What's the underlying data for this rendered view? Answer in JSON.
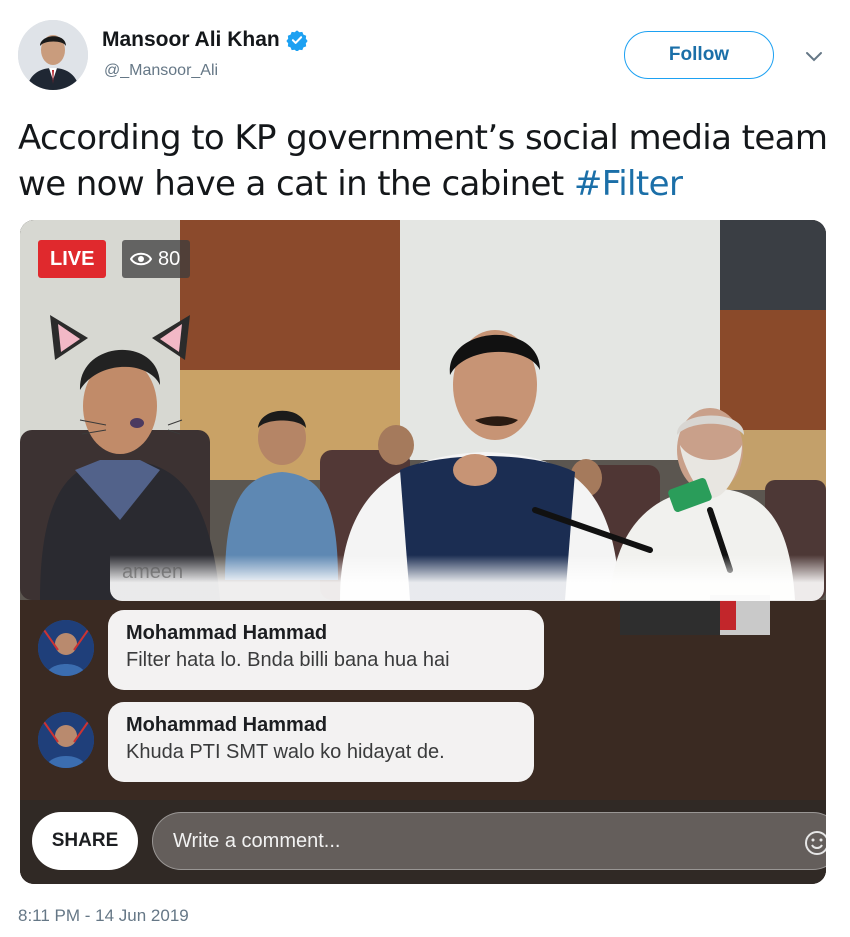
{
  "tweet": {
    "author": {
      "display_name": "Mansoor Ali Khan",
      "handle": "@_Mansoor_Ali",
      "verified": true
    },
    "follow_label": "Follow",
    "text_main": "According to KP government’s social media team we now have a cat in the cabinet",
    "hashtag": "#Filter",
    "timestamp": "8:11 PM - 14 Jun 2019",
    "accent_color": "#1da1f2"
  },
  "video": {
    "live_label": "LIVE",
    "viewer_count": "80",
    "faded_comment": "ameen",
    "comments": [
      {
        "name": "Mohammad Hammad",
        "text": "Filter hata lo. Bnda billi bana hua hai"
      },
      {
        "name": "Mohammad Hammad",
        "text": "Khuda PTI SMT walo ko hidayat de."
      }
    ],
    "share_label": "SHARE",
    "comment_placeholder": "Write a comment...",
    "live_color": "#e0292d"
  },
  "icons": [
    "verified-badge-icon",
    "chevron-down-icon",
    "eye-icon",
    "emoji-icon"
  ]
}
